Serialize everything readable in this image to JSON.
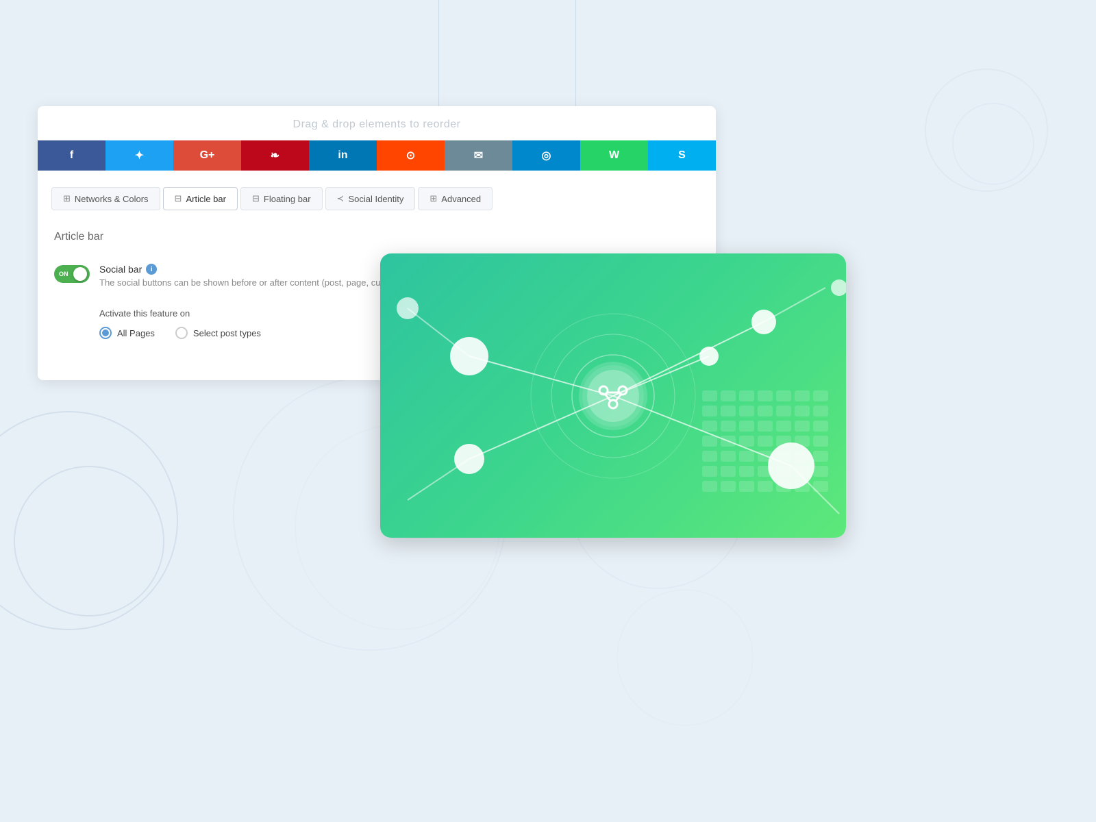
{
  "page": {
    "bg_color": "#e8f0f7"
  },
  "drag_header": {
    "text": "Drag & drop elements to reorder"
  },
  "social_networks": [
    {
      "id": "facebook",
      "color": "#3b5998",
      "icon": "f",
      "label": "Facebook"
    },
    {
      "id": "twitter",
      "color": "#1da1f2",
      "icon": "𝕥",
      "label": "Twitter"
    },
    {
      "id": "google_plus",
      "color": "#dd4b39",
      "icon": "G+",
      "label": "Google+"
    },
    {
      "id": "pinterest",
      "color": "#bd081c",
      "icon": "P",
      "label": "Pinterest"
    },
    {
      "id": "linkedin",
      "color": "#0077b5",
      "icon": "in",
      "label": "LinkedIn"
    },
    {
      "id": "reddit",
      "color": "#ff4500",
      "icon": "⊙",
      "label": "Reddit"
    },
    {
      "id": "email",
      "color": "#6d8a99",
      "icon": "✉",
      "label": "Email"
    },
    {
      "id": "telegram",
      "color": "#0088cc",
      "icon": "◎",
      "label": "Telegram"
    },
    {
      "id": "whatsapp",
      "color": "#25d366",
      "icon": "W",
      "label": "WhatsApp"
    },
    {
      "id": "skype",
      "color": "#00aff0",
      "icon": "S",
      "label": "Skype"
    }
  ],
  "tabs": [
    {
      "id": "networks-colors",
      "label": "Networks & Colors",
      "icon": "⊞",
      "active": false
    },
    {
      "id": "article-bar",
      "label": "Article bar",
      "icon": "⊟",
      "active": true
    },
    {
      "id": "floating-bar",
      "label": "Floating bar",
      "icon": "⊟",
      "active": false
    },
    {
      "id": "social-identity",
      "label": "Social Identity",
      "icon": "≺",
      "active": false
    },
    {
      "id": "advanced",
      "label": "Advanced",
      "icon": "⊞",
      "active": false
    }
  ],
  "article_bar": {
    "section_title": "Article bar",
    "social_bar": {
      "label": "Social bar",
      "description": "The social buttons can be shown before or after content (post, page, custo...",
      "toggle_state": "ON",
      "info_tooltip": "i"
    },
    "activate": {
      "label": "Activate this feature on",
      "options": [
        {
          "id": "all-pages",
          "label": "All Pages",
          "selected": true
        },
        {
          "id": "select-post-types",
          "label": "Select post types",
          "selected": false
        }
      ]
    }
  }
}
